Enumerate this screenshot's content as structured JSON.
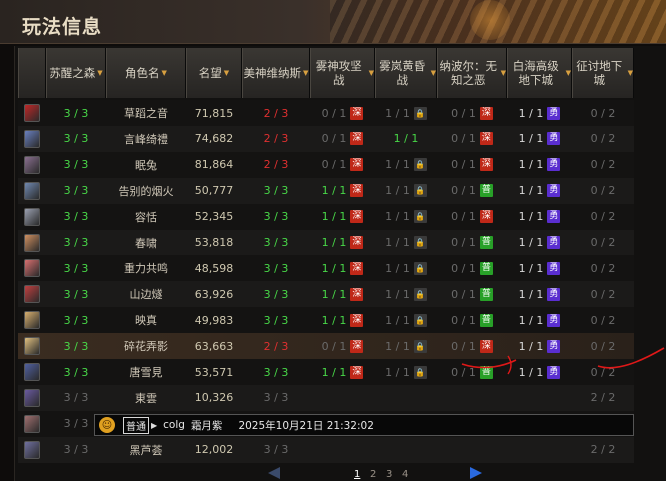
{
  "title": "玩法信息",
  "columns": [
    {
      "label": "",
      "sortable": false
    },
    {
      "label": "苏醒之森",
      "sortable": true
    },
    {
      "label": "角色名",
      "sortable": true
    },
    {
      "label": "名望",
      "sortable": true
    },
    {
      "label": "美神维纳斯",
      "sortable": true
    },
    {
      "label": "雾神攻坚战",
      "sortable": true
    },
    {
      "label": "雾岚黄昏战",
      "sortable": true
    },
    {
      "label": "纳波尔：无知之恶",
      "sortable": true
    },
    {
      "label": "白海高级地下城",
      "sortable": true
    },
    {
      "label": "征讨地下城",
      "sortable": true
    }
  ],
  "rows": [
    {
      "forest": "3 / 3",
      "name": "草蹈之音",
      "fame": "71,815",
      "venus": "2 / 3",
      "mist": "0 / 1",
      "mist_badge": "hell",
      "dusk": "1 / 1",
      "dusk_badge": "lock",
      "napol": "0 / 1",
      "napol_badge": "hell",
      "white": "1 / 1",
      "white_badge": "hero",
      "conquest": "0 / 2",
      "venus_color": "red",
      "forest_color": "green",
      "avatar": "#c02828"
    },
    {
      "forest": "3 / 3",
      "name": "言峰绮禮",
      "fame": "74,682",
      "venus": "2 / 3",
      "mist": "0 / 1",
      "mist_badge": "hell",
      "dusk": "1 / 1",
      "dusk_badge": "",
      "napol": "0 / 1",
      "napol_badge": "hell",
      "white": "1 / 1",
      "white_badge": "hero",
      "conquest": "0 / 2",
      "venus_color": "red",
      "forest_color": "green",
      "avatar": "#6a80c0"
    },
    {
      "forest": "3 / 3",
      "name": "眠兔",
      "fame": "81,864",
      "venus": "2 / 3",
      "mist": "0 / 1",
      "mist_badge": "hell",
      "dusk": "1 / 1",
      "dusk_badge": "lock",
      "napol": "0 / 1",
      "napol_badge": "hell",
      "white": "1 / 1",
      "white_badge": "hero",
      "conquest": "0 / 2",
      "venus_color": "red",
      "forest_color": "green",
      "avatar": "#8a7090"
    },
    {
      "forest": "3 / 3",
      "name": "告别的烟火",
      "fame": "50,777",
      "venus": "3 / 3",
      "mist": "1 / 1",
      "mist_badge": "hell",
      "dusk": "1 / 1",
      "dusk_badge": "lock",
      "napol": "0 / 1",
      "napol_badge": "norm",
      "white": "1 / 1",
      "white_badge": "hero",
      "conquest": "0 / 2",
      "venus_color": "green",
      "forest_color": "green",
      "avatar": "#7088b0"
    },
    {
      "forest": "3 / 3",
      "name": "容恬",
      "fame": "52,345",
      "venus": "3 / 3",
      "mist": "1 / 1",
      "mist_badge": "hell",
      "dusk": "1 / 1",
      "dusk_badge": "lock",
      "napol": "0 / 1",
      "napol_badge": "hell",
      "white": "1 / 1",
      "white_badge": "hero",
      "conquest": "0 / 2",
      "venus_color": "green",
      "forest_color": "green",
      "avatar": "#9aa0b0"
    },
    {
      "forest": "3 / 3",
      "name": "春啸",
      "fame": "53,818",
      "venus": "3 / 3",
      "mist": "1 / 1",
      "mist_badge": "hell",
      "dusk": "1 / 1",
      "dusk_badge": "lock",
      "napol": "0 / 1",
      "napol_badge": "norm",
      "white": "1 / 1",
      "white_badge": "hero",
      "conquest": "0 / 2",
      "venus_color": "green",
      "forest_color": "green",
      "avatar": "#d09060"
    },
    {
      "forest": "3 / 3",
      "name": "重力共鸣",
      "fame": "48,598",
      "venus": "3 / 3",
      "mist": "1 / 1",
      "mist_badge": "hell",
      "dusk": "1 / 1",
      "dusk_badge": "lock",
      "napol": "0 / 1",
      "napol_badge": "norm",
      "white": "1 / 1",
      "white_badge": "hero",
      "conquest": "0 / 2",
      "venus_color": "green",
      "forest_color": "green",
      "avatar": "#d87070"
    },
    {
      "forest": "3 / 3",
      "name": "山边燧",
      "fame": "63,926",
      "venus": "3 / 3",
      "mist": "1 / 1",
      "mist_badge": "hell",
      "dusk": "1 / 1",
      "dusk_badge": "lock",
      "napol": "0 / 1",
      "napol_badge": "norm",
      "white": "1 / 1",
      "white_badge": "hero",
      "conquest": "0 / 2",
      "venus_color": "green",
      "forest_color": "green",
      "avatar": "#c04040"
    },
    {
      "forest": "3 / 3",
      "name": "映真",
      "fame": "49,983",
      "venus": "3 / 3",
      "mist": "1 / 1",
      "mist_badge": "hell",
      "dusk": "1 / 1",
      "dusk_badge": "lock",
      "napol": "0 / 1",
      "napol_badge": "norm",
      "white": "1 / 1",
      "white_badge": "hero",
      "conquest": "0 / 2",
      "venus_color": "green",
      "forest_color": "green",
      "avatar": "#d8b070"
    },
    {
      "forest": "3 / 3",
      "name": "碎花弄影",
      "fame": "63,663",
      "venus": "2 / 3",
      "mist": "0 / 1",
      "mist_badge": "hell",
      "dusk": "1 / 1",
      "dusk_badge": "lock",
      "napol": "0 / 1",
      "napol_badge": "hell",
      "white": "1 / 1",
      "white_badge": "hero",
      "conquest": "0 / 2",
      "venus_color": "red",
      "forest_color": "green",
      "avatar": "#e0c080",
      "highlight": true
    },
    {
      "forest": "3 / 3",
      "name": "唐雪見",
      "fame": "53,571",
      "venus": "3 / 3",
      "mist": "1 / 1",
      "mist_badge": "hell",
      "dusk": "1 / 1",
      "dusk_badge": "lock",
      "napol": "0 / 1",
      "napol_badge": "norm",
      "white": "1 / 1",
      "white_badge": "hero",
      "conquest": "0 / 2",
      "venus_color": "green",
      "forest_color": "green",
      "avatar": "#5060a0"
    },
    {
      "forest": "3 / 3",
      "name": "東雲",
      "fame": "10,326",
      "venus": "3 / 3",
      "mist": "",
      "mist_badge": "",
      "dusk": "",
      "dusk_badge": "",
      "napol": "",
      "napol_badge": "",
      "white": "",
      "white_badge": "",
      "conquest": "2 / 2",
      "venus_color": "gray",
      "forest_color": "gray",
      "avatar": "#6a5aa0"
    },
    {
      "forest": "3 / 3",
      "name": "",
      "fame": "",
      "venus": "",
      "mist": "",
      "mist_badge": "",
      "dusk": "",
      "dusk_badge": "",
      "napol": "",
      "napol_badge": "",
      "white": "",
      "white_badge": "",
      "conquest": "",
      "venus_color": "gray",
      "forest_color": "gray",
      "avatar": "#a07070"
    },
    {
      "forest": "3 / 3",
      "name": "黑芦荟",
      "fame": "12,002",
      "venus": "3 / 3",
      "mist": "",
      "mist_badge": "",
      "dusk": "",
      "dusk_badge": "",
      "napol": "",
      "napol_badge": "",
      "white": "",
      "white_badge": "",
      "conquest": "2 / 2",
      "venus_color": "gray",
      "forest_color": "gray",
      "avatar": "#7070a0"
    }
  ],
  "badges": {
    "hell": "深",
    "hero": "勇",
    "norm": "普",
    "lock": "🔒"
  },
  "tooltip": {
    "emoji": "☺",
    "channel": "普通",
    "source": "colg",
    "user": "霜月紫",
    "datetime": "2025年10月21日 21:32:02"
  },
  "pager": {
    "pages": [
      "1",
      "2",
      "3",
      "4"
    ],
    "current": "1"
  }
}
